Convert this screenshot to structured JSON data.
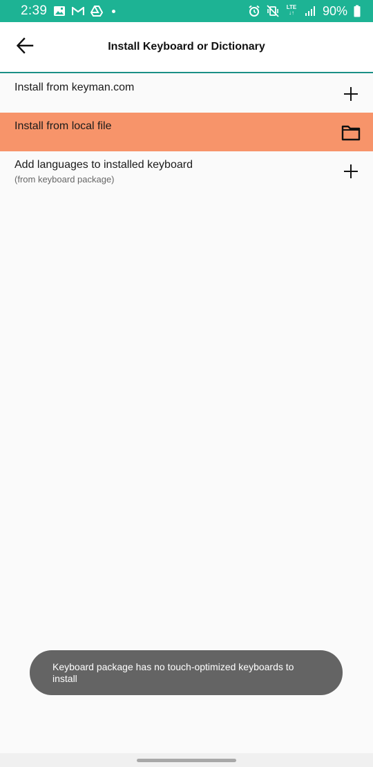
{
  "status_bar": {
    "time": "2:39",
    "network": "LTE",
    "battery": "90%",
    "icons": [
      "gallery-icon",
      "gmail-icon",
      "drive-icon",
      "notification-dot",
      "alarm-icon",
      "vibrate-icon",
      "lte-icon",
      "signal-icon",
      "battery-icon"
    ]
  },
  "app_bar": {
    "title": "Install Keyboard or Dictionary",
    "back_icon": "arrow-left-icon"
  },
  "list": {
    "items": [
      {
        "title": "Install from keyman.com",
        "subtitle": "",
        "icon": "plus-icon",
        "highlighted": false
      },
      {
        "title": "Install from local file",
        "subtitle": "",
        "icon": "folder-icon",
        "highlighted": true
      },
      {
        "title": "Add languages to installed keyboard",
        "subtitle": "(from keyboard package)",
        "icon": "plus-icon",
        "highlighted": false
      }
    ]
  },
  "toast": {
    "message": "Keyboard package has no touch-optimized keyboards to install"
  },
  "colors": {
    "status_bar": "#1db394",
    "app_bar_divider": "#1a8f86",
    "highlight": "#f7946a",
    "toast_bg": "#646464"
  }
}
